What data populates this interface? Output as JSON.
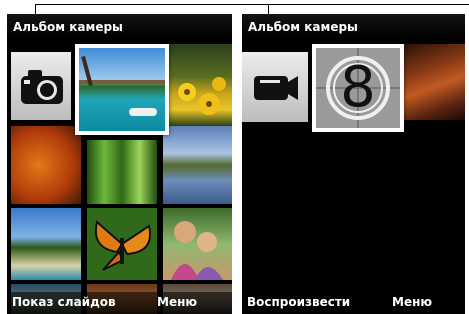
{
  "left_screen": {
    "title": "Альбом камеры",
    "softkey_left": "Показ слайдов",
    "softkey_right": "Меню",
    "first_item_icon": "camera-icon"
  },
  "right_screen": {
    "title": "Альбом камеры",
    "softkey_left": "Воспроизвести",
    "softkey_right": "Меню",
    "first_item_icon": "video-camera-icon",
    "selected_video_frame_number": "8"
  },
  "colors": {
    "screen_bg": "#000000",
    "tile_frame": "#ffffff"
  }
}
